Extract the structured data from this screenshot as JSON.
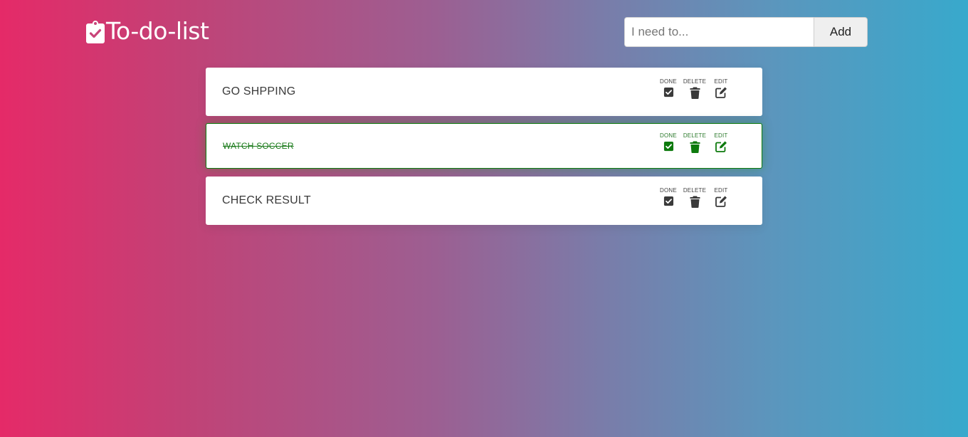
{
  "header": {
    "title": "To-do-list",
    "logo_icon": "clipboard-check-icon"
  },
  "add_form": {
    "placeholder": "I need to...",
    "value": "",
    "add_label": "Add"
  },
  "colors": {
    "gradient_left": "#e52a68",
    "gradient_right": "#38a9cc",
    "done_green": "#0d7a0d",
    "icon_dark": "#3a3a3a"
  },
  "action_labels": {
    "done": "DONE",
    "delete": "DELETE",
    "edit": "EDIT"
  },
  "tasks": [
    {
      "text": "GO SHPPING",
      "done": false
    },
    {
      "text": "WATCH SOCCER",
      "done": true
    },
    {
      "text": "CHECK RESULT",
      "done": false
    }
  ]
}
